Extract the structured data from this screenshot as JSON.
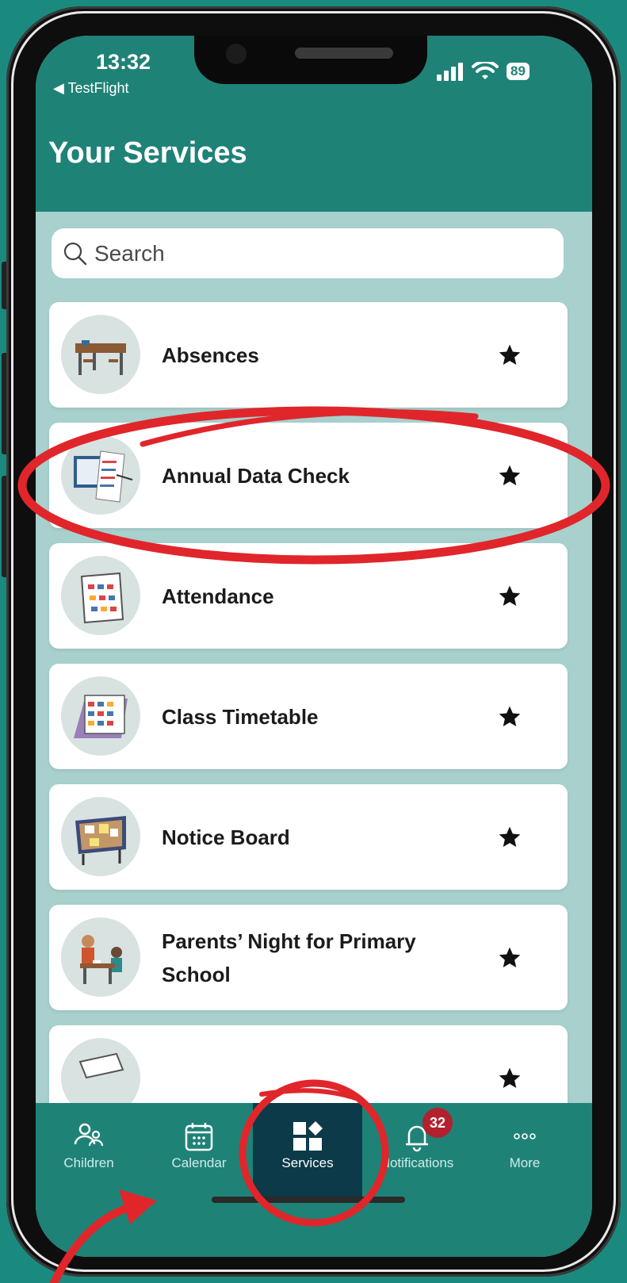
{
  "status_bar": {
    "time": "13:32",
    "back_app": "◀ TestFlight",
    "battery": "89"
  },
  "header": {
    "title": "Your Services"
  },
  "search": {
    "placeholder": "Search"
  },
  "services": [
    {
      "label": "Absences",
      "icon": "classroom-desks-icon",
      "starred": true
    },
    {
      "label": "Annual Data Check",
      "icon": "data-check-document-icon",
      "starred": true
    },
    {
      "label": "Attendance",
      "icon": "attendance-calendar-icon",
      "starred": true
    },
    {
      "label": "Class Timetable",
      "icon": "timetable-calendar-icon",
      "starred": true
    },
    {
      "label": "Notice Board",
      "icon": "notice-board-icon",
      "starred": true
    },
    {
      "label": "Parents’ Night for Primary School",
      "icon": "parent-meeting-icon",
      "starred": true
    }
  ],
  "tabs": [
    {
      "label": "Children",
      "icon": "children-icon"
    },
    {
      "label": "Calendar",
      "icon": "calendar-icon"
    },
    {
      "label": "Services",
      "icon": "services-icon",
      "active": true
    },
    {
      "label": "Notifications",
      "icon": "bell-icon",
      "badge": "32"
    },
    {
      "label": "More",
      "icon": "more-dots-icon"
    }
  ],
  "colors": {
    "background": "#1a8a7e",
    "header": "#1f8277",
    "content": "#a8d0cd",
    "active_tab": "#0c3a48",
    "annotation": "#e0262b",
    "badge": "#b3202e"
  }
}
